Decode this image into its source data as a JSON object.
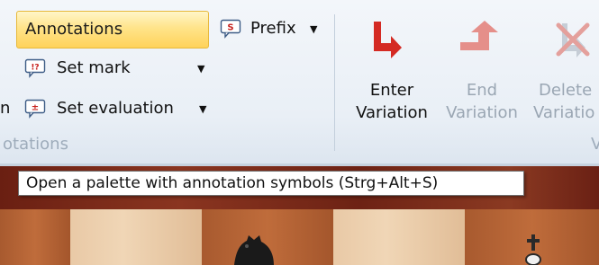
{
  "ribbon": {
    "annotations_label": "Annotations",
    "prefix_label": "Prefix",
    "set_mark_label": "Set mark",
    "set_evaluation_label": "Set evaluation",
    "left_fragment": "n",
    "group_label_left": "otations",
    "group_label_right": "V",
    "enter_variation": {
      "line1": "Enter",
      "line2": "Variation"
    },
    "end_variation": {
      "line1": "End",
      "line2": "Variation"
    },
    "delete_variation": {
      "line1": "Delete",
      "line2": "Variatio"
    }
  },
  "icons": {
    "prefix": "note-s-icon",
    "set_mark": "note-exclaim-question-icon",
    "set_evaluation": "note-plusminus-icon",
    "enter_variation": "enter-variation-arrow-icon",
    "end_variation": "end-variation-arrow-icon",
    "delete_variation": "delete-variation-icon"
  },
  "tooltip": {
    "text": "Open a palette with annotation symbols (Strg+Alt+S)"
  },
  "colors": {
    "accent_red": "#d42a23",
    "faded_red": "#e58f8a",
    "highlight_yellow": "#ffd25a"
  }
}
